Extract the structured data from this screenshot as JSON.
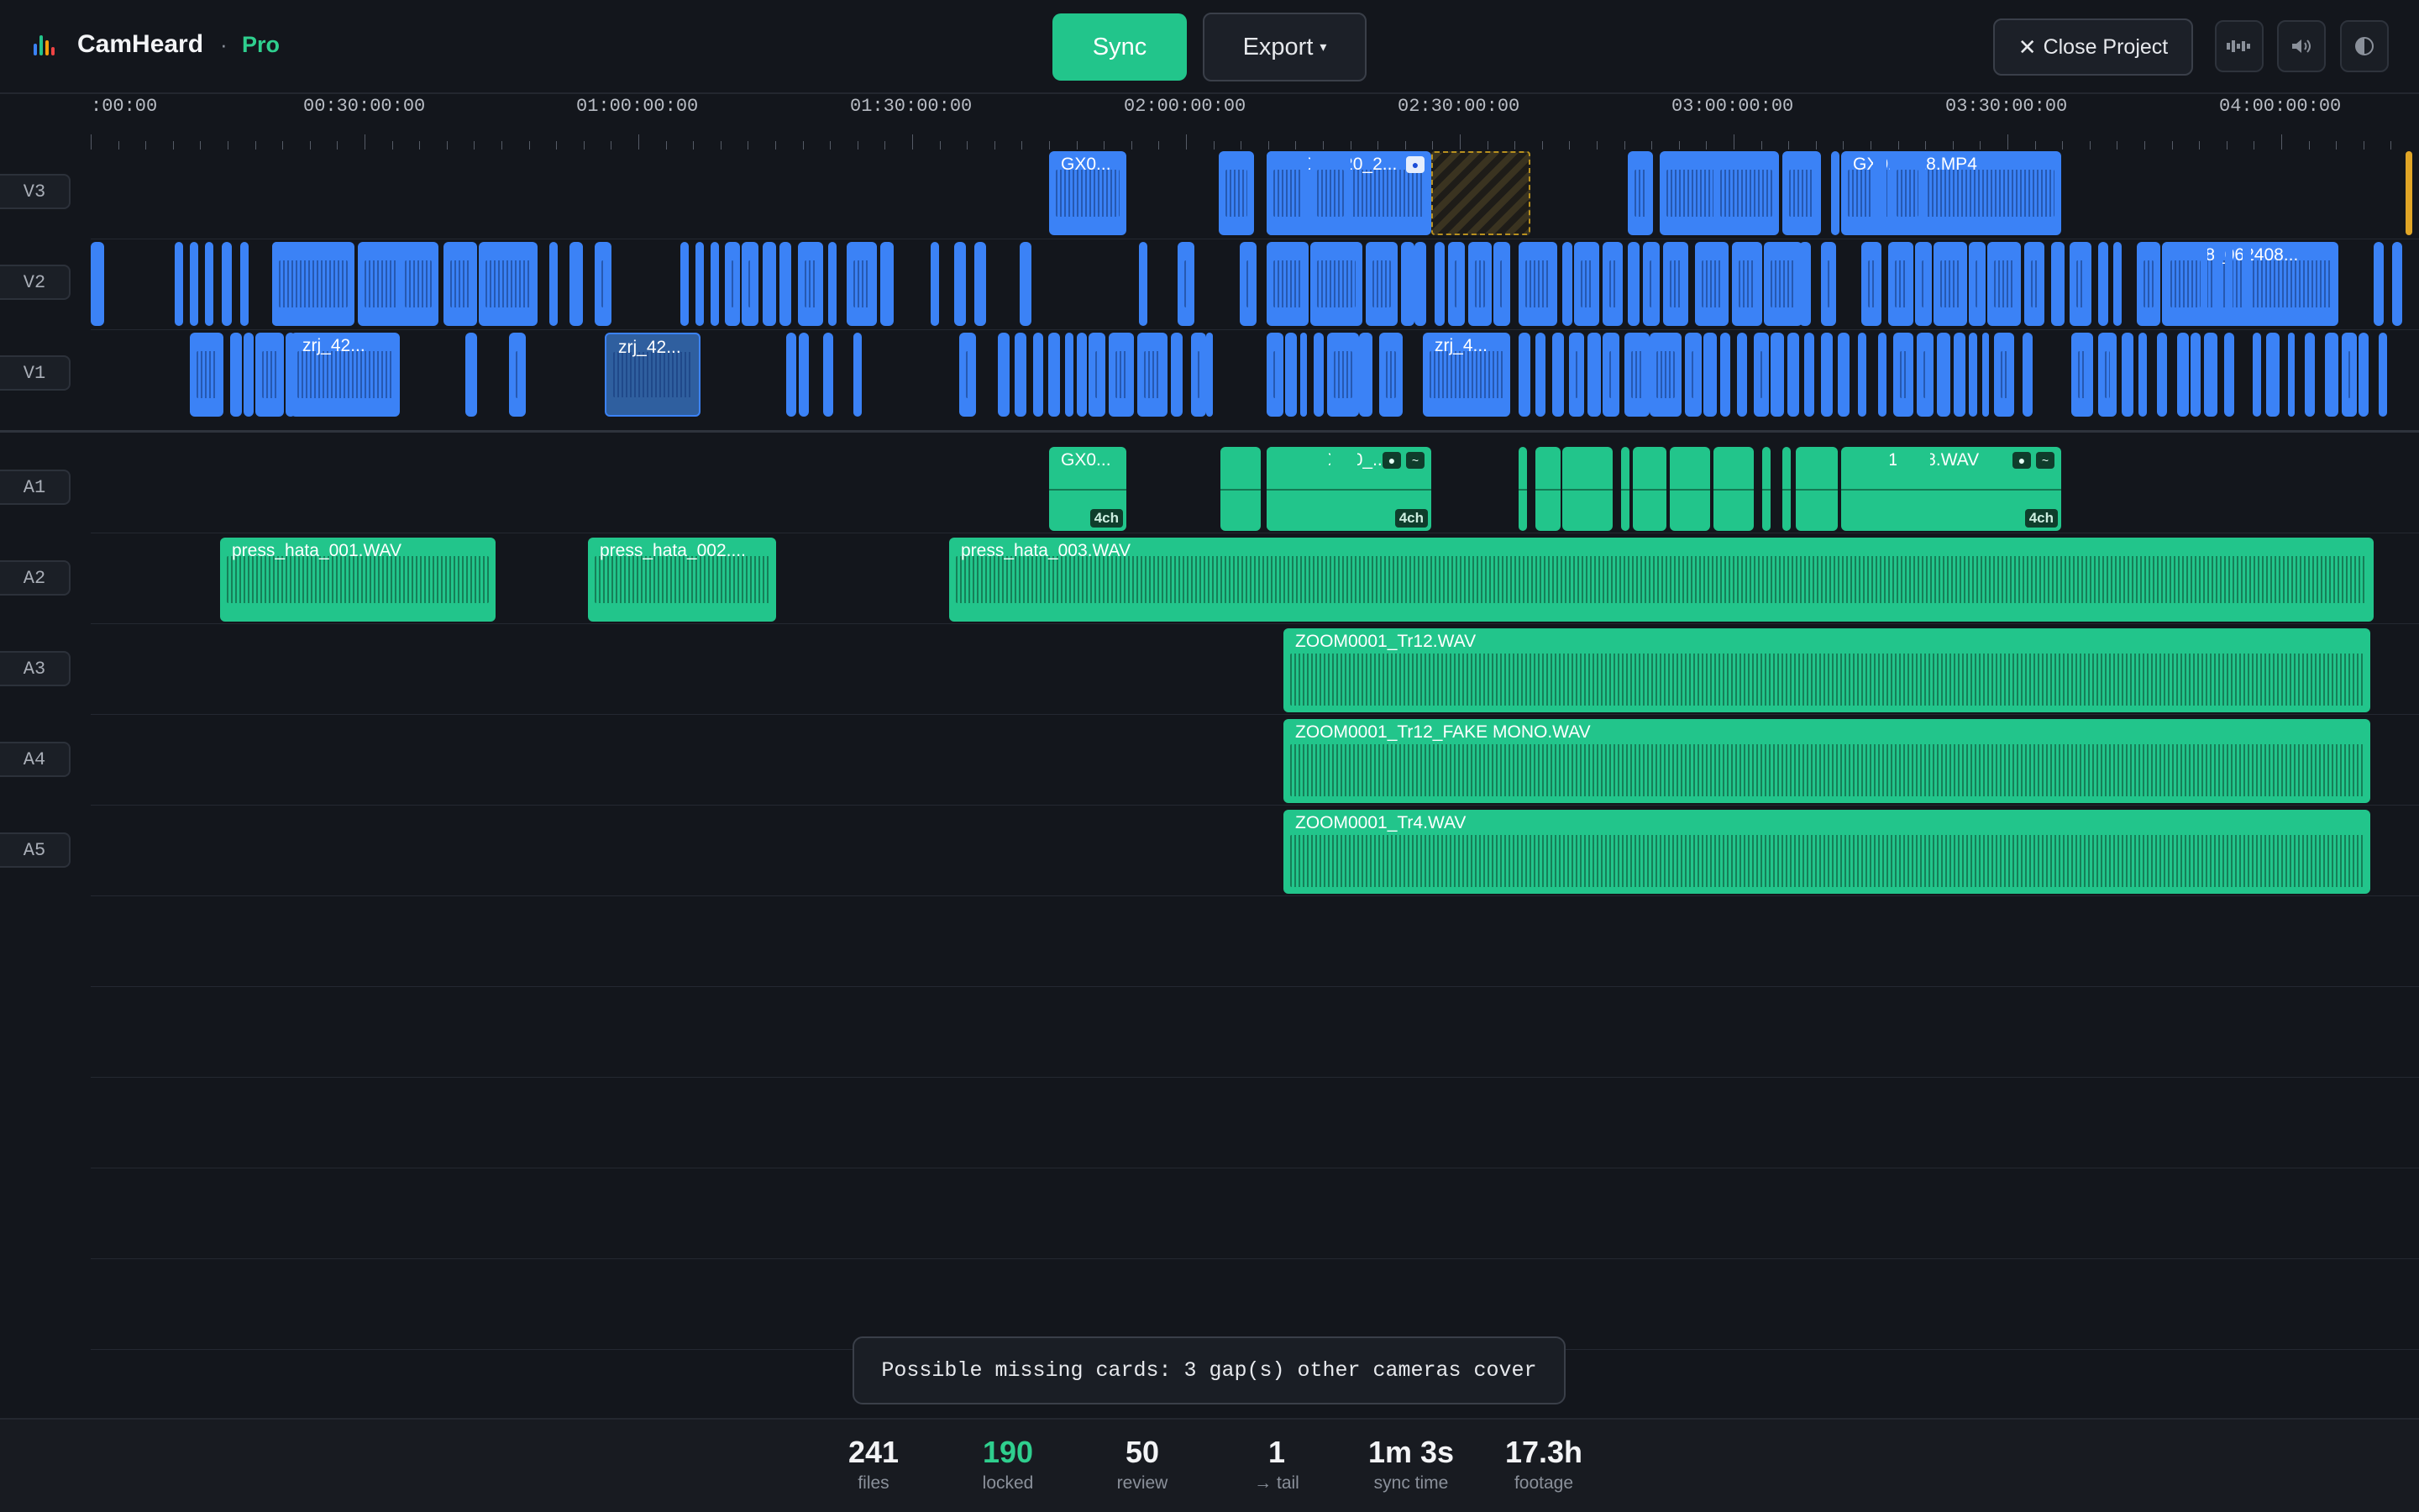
{
  "app": {
    "name": "CamHeard",
    "separator": "·",
    "tier": "Pro"
  },
  "toolbar": {
    "sync_label": "Sync",
    "export_label": "Export",
    "export_caret": "▾",
    "close_label": "Close Project",
    "close_icon": "✕"
  },
  "icons": [
    "waveform-icon",
    "speaker-icon",
    "contrast-icon"
  ],
  "ruler": {
    "labels": [
      ":00:00",
      "00:30:00:00",
      "01:00:00:00",
      "01:30:00:00",
      "02:00:00:00",
      "02:30:00:00",
      "03:00:00:00",
      "03:30:00:00",
      "04:00:00:00"
    ]
  },
  "tracks": {
    "video": [
      "V3",
      "V2",
      "V1"
    ],
    "audio": [
      "A1",
      "A2",
      "A3",
      "A4",
      "A5"
    ]
  },
  "clip_names": {
    "v3_a": "GX0...",
    "v3_b": "GX010120_2...",
    "v3_c": "GX010118.MP4",
    "v2_a": "A028_062408...",
    "v1_a": "zrj_42...",
    "v1_b": "zrj_42...",
    "v1_c": "zrj_4...",
    "a1_a": "GX0...",
    "a1_b": "GX010120_...",
    "a1_c": "GX010118.WAV",
    "a2_a": "press_hata_001.WAV",
    "a2_b": "press_hata_002....",
    "a2_c": "press_hata_003.WAV",
    "a3_a": "ZOOM0001_Tr12.WAV",
    "a4_a": "ZOOM0001_Tr12_FAKE MONO.WAV",
    "a5_a": "ZOOM0001_Tr4.WAV"
  },
  "channel_badge": "4ch",
  "toast": "Possible missing cards: 3 gap(s) other cameras cover",
  "stats": [
    {
      "value": "241",
      "label": "files"
    },
    {
      "value": "190",
      "label": "locked"
    },
    {
      "value": "50",
      "label": "review"
    },
    {
      "value": "1",
      "label": "→ tail"
    },
    {
      "value": "1m 3s",
      "label": "sync time"
    },
    {
      "value": "17.3h",
      "label": "footage"
    }
  ],
  "colors": {
    "video_clip": "#3b82f6",
    "audio_clip": "#22c58b",
    "accent": "#2fcf8e",
    "background": "#13161c"
  }
}
